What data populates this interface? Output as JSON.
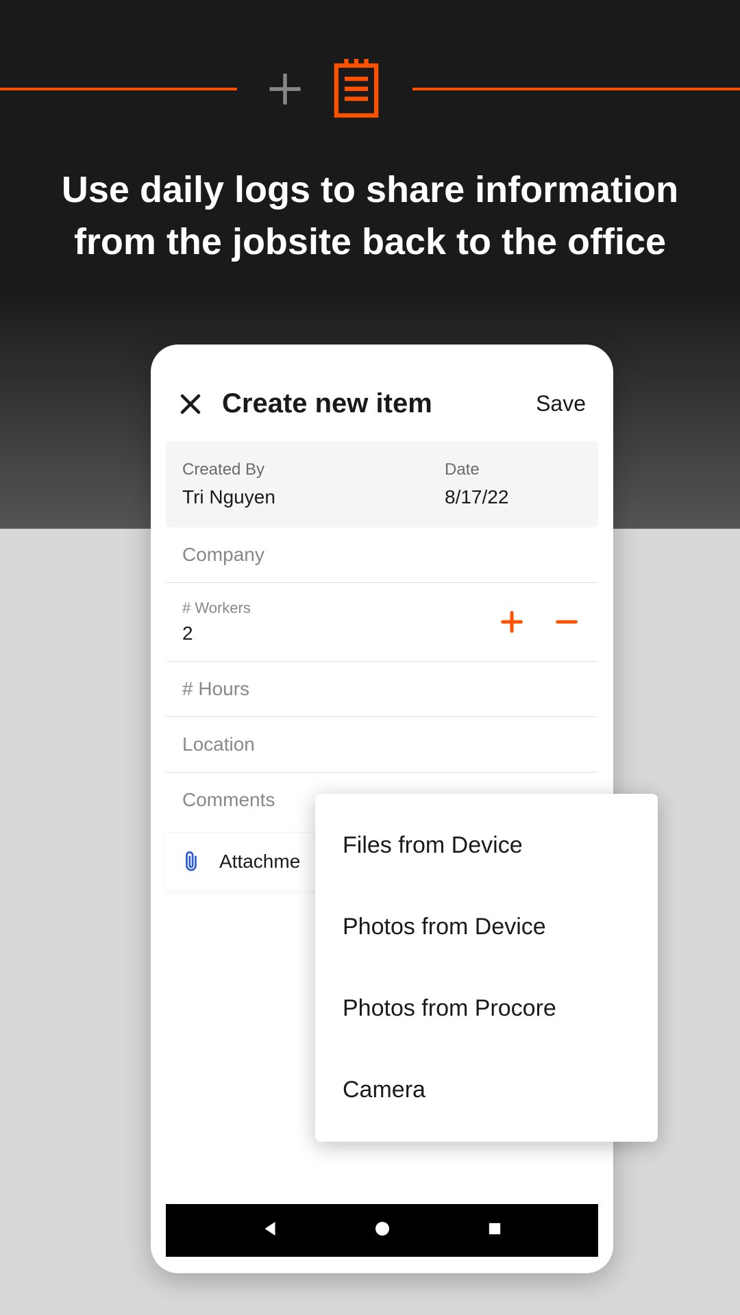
{
  "headline": "Use daily logs to share information from the jobsite back to the office",
  "colors": {
    "accent": "#ff5200",
    "link": "#2a5bd7"
  },
  "app": {
    "title": "Create new item",
    "save_label": "Save",
    "meta": {
      "created_by_label": "Created By",
      "created_by_value": "Tri Nguyen",
      "date_label": "Date",
      "date_value": "8/17/22"
    },
    "fields": {
      "company_placeholder": "Company",
      "workers_label": "# Workers",
      "workers_value": "2",
      "hours_placeholder": "# Hours",
      "location_placeholder": "Location",
      "comments_placeholder": "Comments"
    },
    "attachments_label": "Attachme"
  },
  "popup": {
    "items": [
      "Files from Device",
      "Photos from Device",
      "Photos from Procore",
      "Camera"
    ]
  }
}
